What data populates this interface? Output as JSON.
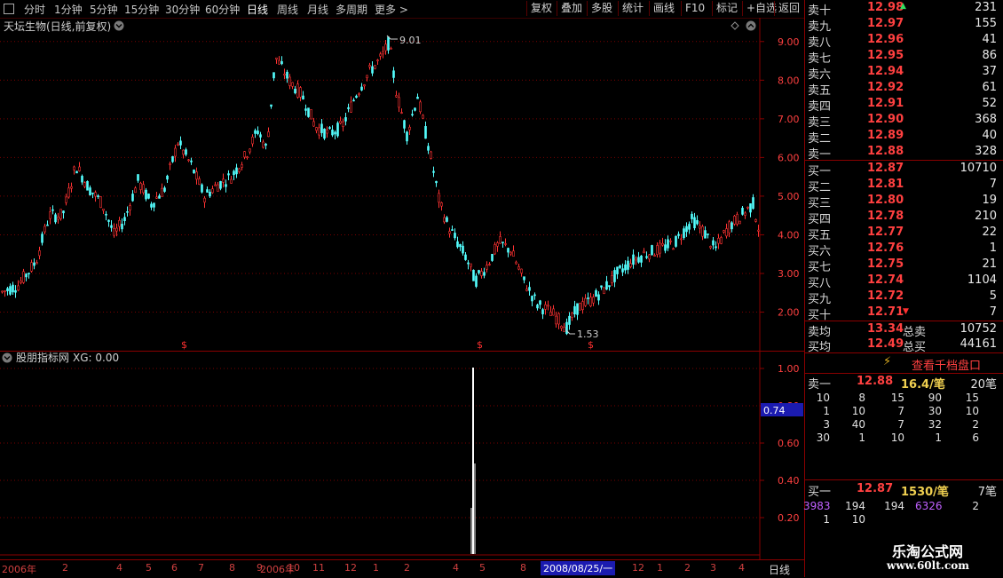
{
  "toolbar": {
    "periods": [
      "分时",
      "1分钟",
      "5分钟",
      "15分钟",
      "30分钟",
      "60分钟",
      "日线",
      "周线",
      "月线",
      "多周期",
      "更多 >"
    ],
    "active_period": "日线",
    "buttons": [
      "复权",
      "叠加",
      "多股",
      "统计",
      "画线",
      "F10",
      "标记",
      "+自选",
      "返回"
    ]
  },
  "main_chart": {
    "title": "天坛生物(日线,前复权)",
    "y_ticks": [
      "9.00",
      "8.00",
      "7.00",
      "6.00",
      "5.00",
      "4.00",
      "3.00",
      "2.00"
    ],
    "high_label": "9.01",
    "low_label": "1.53",
    "signal_symbol": "$"
  },
  "indicator": {
    "title": "股朋指标网",
    "value_label": "XG: 0.00",
    "y_ticks": [
      "1.00",
      "0.80",
      "0.60",
      "0.40",
      "0.20"
    ],
    "cursor_value": "0.74"
  },
  "bottom_axis": {
    "labels": [
      "2006年",
      "2",
      "4",
      "5",
      "6",
      "7",
      "8",
      "9",
      "2006年",
      "10",
      "11",
      "12",
      "1",
      "2",
      "4",
      "5",
      "8",
      "2008/08/25/一",
      "12",
      "1",
      "2",
      "3",
      "4"
    ],
    "period_label": "日线"
  },
  "order_book": {
    "sell": [
      {
        "label": "卖十",
        "price": "12.98",
        "vol": "231"
      },
      {
        "label": "卖九",
        "price": "12.97",
        "vol": "155"
      },
      {
        "label": "卖八",
        "price": "12.96",
        "vol": "41"
      },
      {
        "label": "卖七",
        "price": "12.95",
        "vol": "86"
      },
      {
        "label": "卖六",
        "price": "12.94",
        "vol": "37"
      },
      {
        "label": "卖五",
        "price": "12.92",
        "vol": "61"
      },
      {
        "label": "卖四",
        "price": "12.91",
        "vol": "52"
      },
      {
        "label": "卖三",
        "price": "12.90",
        "vol": "368"
      },
      {
        "label": "卖二",
        "price": "12.89",
        "vol": "40"
      },
      {
        "label": "卖一",
        "price": "12.88",
        "vol": "328"
      }
    ],
    "buy": [
      {
        "label": "买一",
        "price": "12.87",
        "vol": "10710"
      },
      {
        "label": "买二",
        "price": "12.81",
        "vol": "7"
      },
      {
        "label": "买三",
        "price": "12.80",
        "vol": "19"
      },
      {
        "label": "买四",
        "price": "12.78",
        "vol": "210"
      },
      {
        "label": "买五",
        "price": "12.77",
        "vol": "22"
      },
      {
        "label": "买六",
        "price": "12.76",
        "vol": "1"
      },
      {
        "label": "买七",
        "price": "12.75",
        "vol": "21"
      },
      {
        "label": "买八",
        "price": "12.74",
        "vol": "1104"
      },
      {
        "label": "买九",
        "price": "12.72",
        "vol": "5"
      },
      {
        "label": "买十",
        "price": "12.71",
        "vol": "7"
      }
    ],
    "avg": [
      {
        "label": "卖均",
        "price": "13.34",
        "tlabel": "总卖",
        "total": "10752"
      },
      {
        "label": "买均",
        "price": "12.49",
        "tlabel": "总买",
        "total": "44161"
      }
    ],
    "depth_button": "查看千档盘口",
    "sell1": {
      "label": "卖一",
      "price": "12.88",
      "per": "16.4/笔",
      "count": "20笔"
    },
    "sell_queue": [
      [
        "10",
        "8",
        "15",
        "90",
        "15"
      ],
      [
        "1",
        "10",
        "7",
        "30",
        "10"
      ],
      [
        "3",
        "40",
        "7",
        "32",
        "2"
      ],
      [
        "30",
        "1",
        "10",
        "1",
        "6"
      ]
    ],
    "buy1": {
      "label": "买一",
      "price": "12.87",
      "per": "1530/笔",
      "count": "7笔"
    },
    "buy_queue": [
      [
        "3983",
        "194",
        "194",
        "6326",
        "2"
      ],
      [
        "1",
        "10",
        "",
        "",
        ""
      ]
    ]
  },
  "watermark": {
    "name": "乐淘公式网",
    "url": "www.60lt.com"
  },
  "colors": {
    "up": "#ff3232",
    "down": "#54ffff",
    "grid": "#7a0000",
    "price": "#ff4040"
  }
}
